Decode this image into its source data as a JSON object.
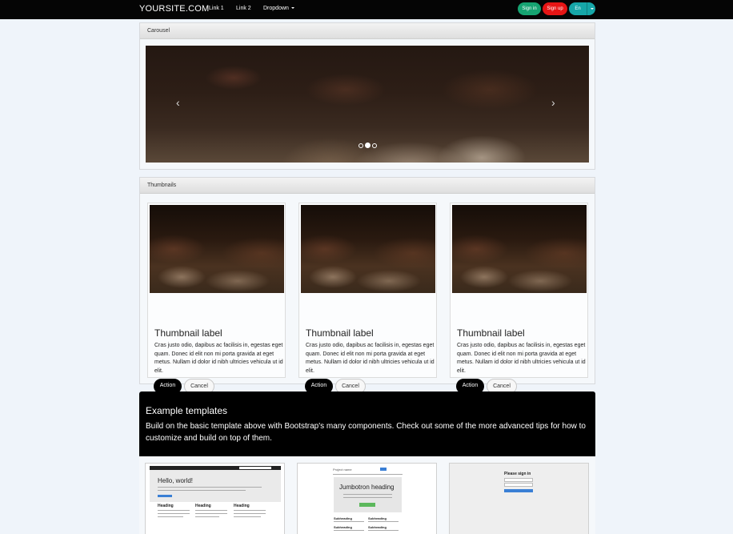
{
  "navbar": {
    "brand": "YOURSITE.COM",
    "links": [
      "Link 1",
      "Link 2"
    ],
    "dropdown_label": "Dropdown",
    "sign_in": "Sign in",
    "sign_up": "Sign up",
    "language": "En",
    "colors": {
      "background": "#050505",
      "sign_in": "#16a472",
      "sign_up": "#e61515",
      "language": "#16a6a8"
    }
  },
  "carousel": {
    "heading": "Carousel",
    "prev_icon": "chevron-left-icon",
    "next_icon": "chevron-right-icon",
    "indicators": {
      "count": 3,
      "active_index": 1
    }
  },
  "thumbnails": {
    "heading": "Thumbnails",
    "items": [
      {
        "title": "Thumbnail label",
        "text": "Cras justo odio, dapibus ac facilisis in, egestas eget quam. Donec id elit non mi porta gravida at eget metus. Nullam id dolor id nibh ultricies vehicula ut id elit.",
        "action": "Action",
        "cancel": "Cancel"
      },
      {
        "title": "Thumbnail label",
        "text": "Cras justo odio, dapibus ac facilisis in, egestas eget quam. Donec id elit non mi porta gravida at eget metus. Nullam id dolor id nibh ultricies vehicula ut id elit.",
        "action": "Action",
        "cancel": "Cancel"
      },
      {
        "title": "Thumbnail label",
        "text": "Cras justo odio, dapibus ac facilisis in, egestas eget quam. Donec id elit non mi porta gravida at eget metus. Nullam id dolor id nibh ultricies vehicula ut id elit.",
        "action": "Action",
        "cancel": "Cancel"
      }
    ]
  },
  "templates": {
    "title": "Example templates",
    "description": "Build on the basic template above with Bootstrap's many components. Check out some of the more advanced tips for how to customize and build on top of them.",
    "previews": [
      {
        "hero_title": "Hello, world!",
        "headings": [
          "Heading",
          "Heading",
          "Heading"
        ]
      },
      {
        "project": "Project name",
        "hero_title": "Jumbotron heading",
        "subheadings": [
          "Subheading",
          "Subheading",
          "Subheading",
          "Subheading"
        ]
      },
      {
        "title": "Please sign in"
      }
    ]
  }
}
